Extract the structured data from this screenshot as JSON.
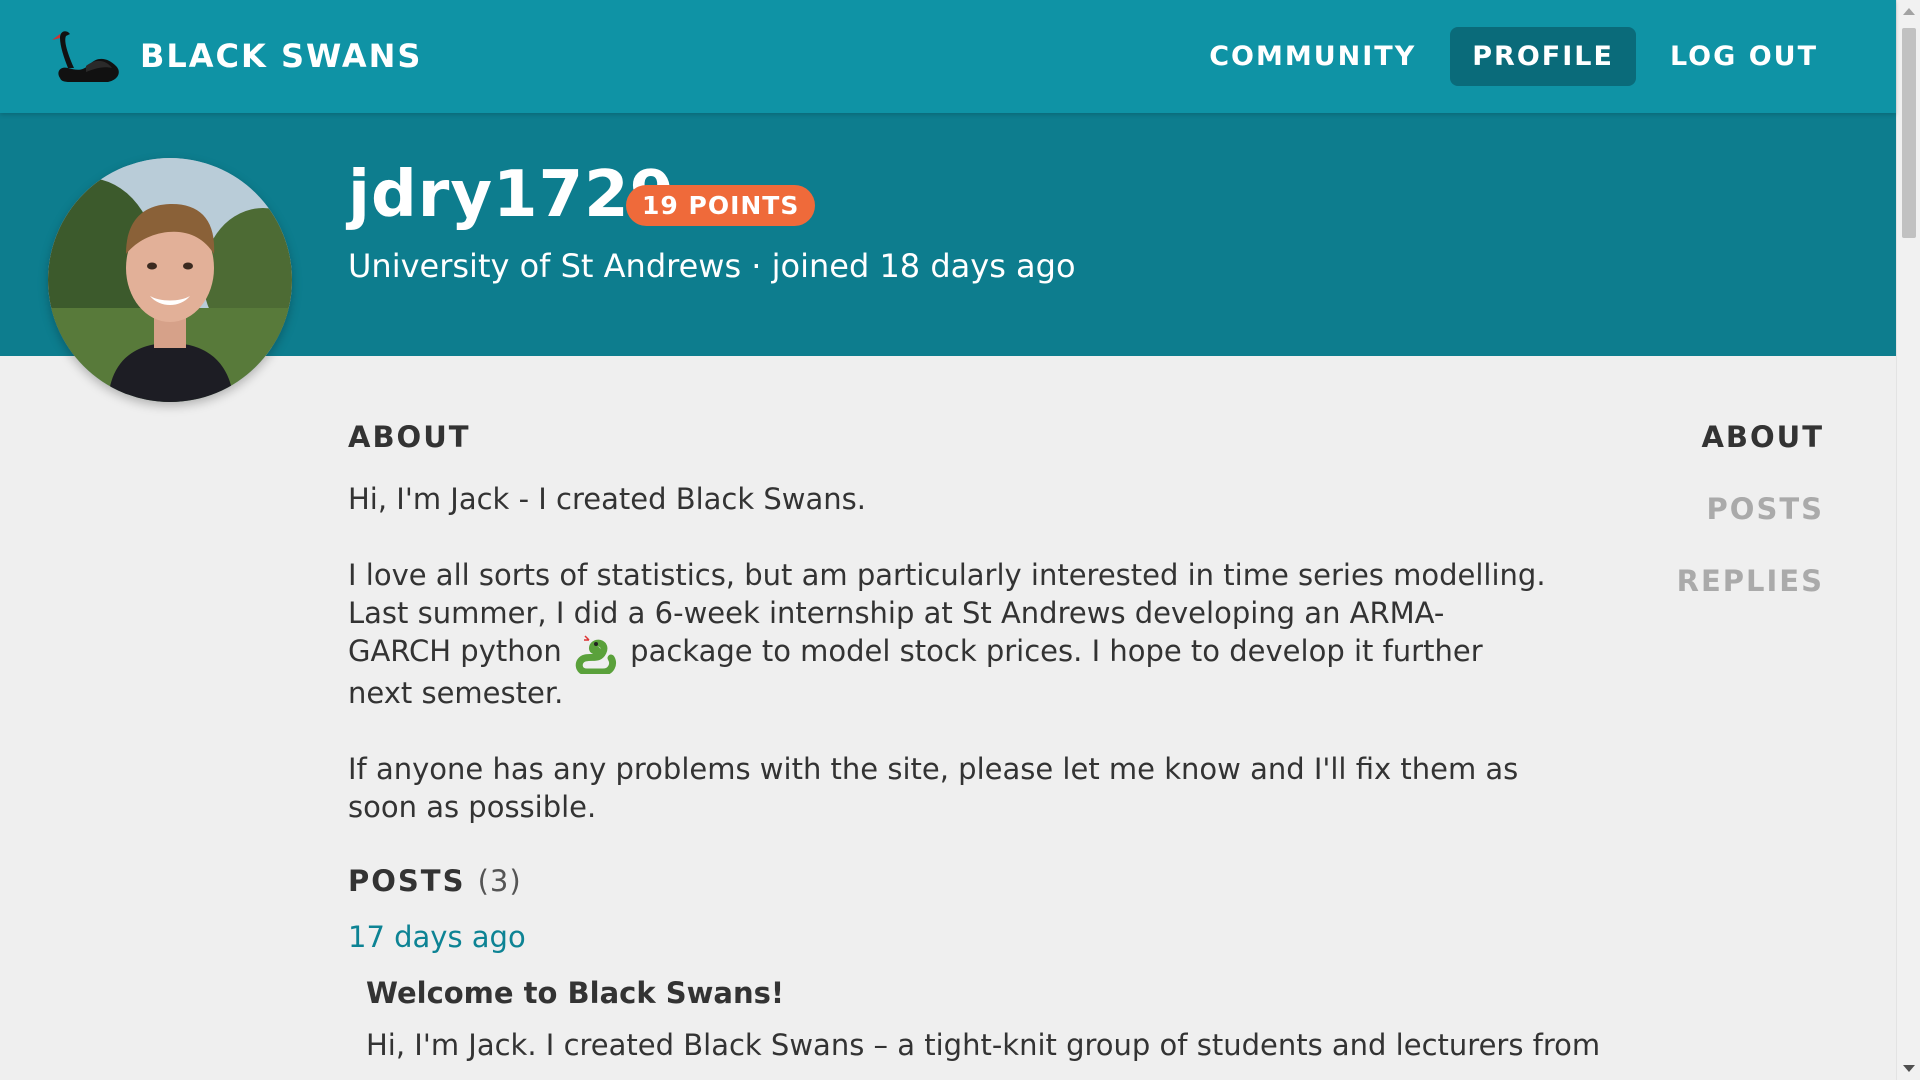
{
  "header": {
    "brand_name": "BLACK SWANS",
    "nav": [
      {
        "label": "COMMUNITY",
        "active": false
      },
      {
        "label": "PROFILE",
        "active": true
      },
      {
        "label": "LOG OUT",
        "active": false
      }
    ]
  },
  "profile": {
    "username": "jdry1729",
    "points_label": "19 POINTS",
    "subtitle": "University of St Andrews · joined 18 days ago"
  },
  "about": {
    "title": "ABOUT",
    "para1": "Hi, I'm Jack - I created Black Swans.",
    "para2_part1": "I love all sorts of statistics, but am particularly interested in time series modelling. Last summer, I did a 6-week internship at St Andrews developing an ARMA-GARCH python",
    "para2_part2": "package to model stock prices. I hope to develop it further next semester.",
    "para3": "If anyone has any problems with the site, please let me know and I'll fix them as soon as possible."
  },
  "posts": {
    "title": "POSTS",
    "count": "(3)",
    "items": [
      {
        "date": "17 days ago",
        "title": "Welcome to Black Swans!",
        "excerpt": "Hi, I'm Jack. I created Black Swans – a tight-knit group of students and lecturers from"
      }
    ]
  },
  "side_nav": [
    {
      "label": "ABOUT",
      "active": true
    },
    {
      "label": "POSTS",
      "active": false
    },
    {
      "label": "REPLIES",
      "active": false
    }
  ],
  "colors": {
    "header": "#0f93a5",
    "banner": "#0d7d8e",
    "active_nav": "#0a6b7a",
    "badge": "#ef6a3a",
    "link": "#0d8394"
  },
  "icons": [
    "black-swan-logo-icon",
    "python-snake-icon"
  ]
}
